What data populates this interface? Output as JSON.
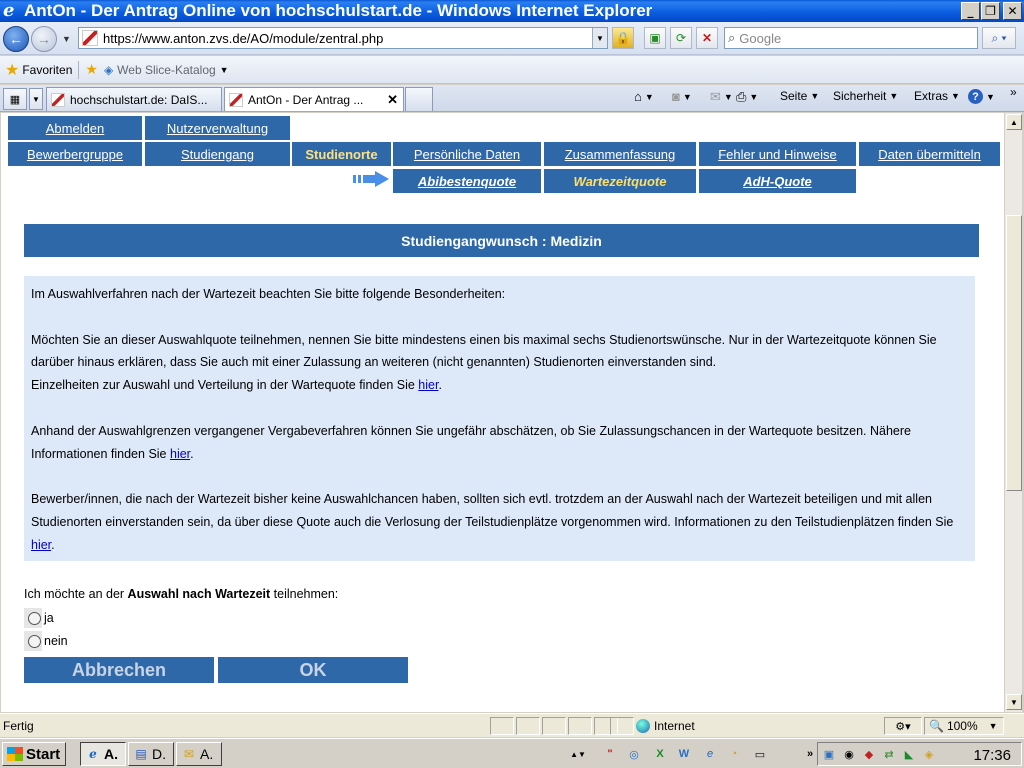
{
  "window": {
    "title": "AntOn - Der Antrag Online von hochschulstart.de - Windows Internet Explorer",
    "min": "_",
    "max": "❐",
    "close": "✕"
  },
  "address": {
    "url": "https://www.anton.zvs.de/AO/module/zentral.php",
    "search_placeholder": "Google"
  },
  "favorites": {
    "label": "Favoriten",
    "slice_label": "Web Slice-Katalog"
  },
  "tabs": [
    {
      "label": "hochschulstart.de: DaIS..."
    },
    {
      "label": "AntOn - Der Antrag ..."
    }
  ],
  "commands": {
    "page": "Seite",
    "security": "Sicherheit",
    "extras": "Extras"
  },
  "nav": {
    "row1": [
      "Abmelden",
      "Nutzerverwaltung"
    ],
    "row2": [
      "Bewerbergruppe",
      "Studiengang",
      "Studienorte",
      "Persönliche Daten",
      "Zusammenfassung",
      "Fehler und Hinweise",
      "Daten übermitteln"
    ],
    "row3": [
      "Abibestenquote",
      "Wartezeitquote",
      "AdH-Quote"
    ]
  },
  "main": {
    "header": "Studiengangwunsch : Medizin",
    "intro": "Im Auswahlverfahren nach der Wartezeit beachten Sie bitte folgende Besonderheiten:",
    "para1": "Möchten Sie an dieser Auswahlquote teilnehmen, nennen Sie bitte mindestens einen bis maximal sechs Studienortswünsche. Nur in der Wartezeitquote können Sie darüber hinaus erklären, dass Sie auch mit einer Zulassung an weiteren (nicht genannten) Studienorten einverstanden sind.",
    "para1b": "Einzelheiten zur Auswahl und Verteilung in der Wartequote finden Sie",
    "para2": "Anhand der Auswahlgrenzen vergangener Vergabeverfahren können Sie ungefähr abschätzen, ob Sie Zulassungschancen in der Wartequote besitzen. Nähere Informationen finden Sie",
    "para3": "Bewerber/innen, die nach der Wartezeit bisher keine Auswahlchancen haben, sollten sich evtl. trotzdem an der Auswahl nach der Wartezeit beteiligen und mit allen Studienorten einverstanden sein, da über diese Quote auch die Verlosung der Teilstudienplätze vorgenommen wird. Informationen zu den Teilstudienplätzen finden Sie",
    "link": "hier",
    "question_pre": "Ich möchte an der",
    "question_bold": "Auswahl nach Wartezeit",
    "question_post": "teilnehmen:",
    "opt_yes": "ja",
    "opt_no": "nein",
    "btn_cancel": "Abbrechen",
    "btn_ok": "OK"
  },
  "status": {
    "text": "Fertig",
    "zone": "Internet",
    "zoom": "100%"
  },
  "taskbar": {
    "start": "Start",
    "items": [
      "A.",
      "D.",
      "A."
    ],
    "clock": "17:36"
  },
  "colors": {
    "nav_bg": "#2e68a8",
    "nav_active_text": "#ffe066",
    "info_bg": "#dde8f8"
  }
}
